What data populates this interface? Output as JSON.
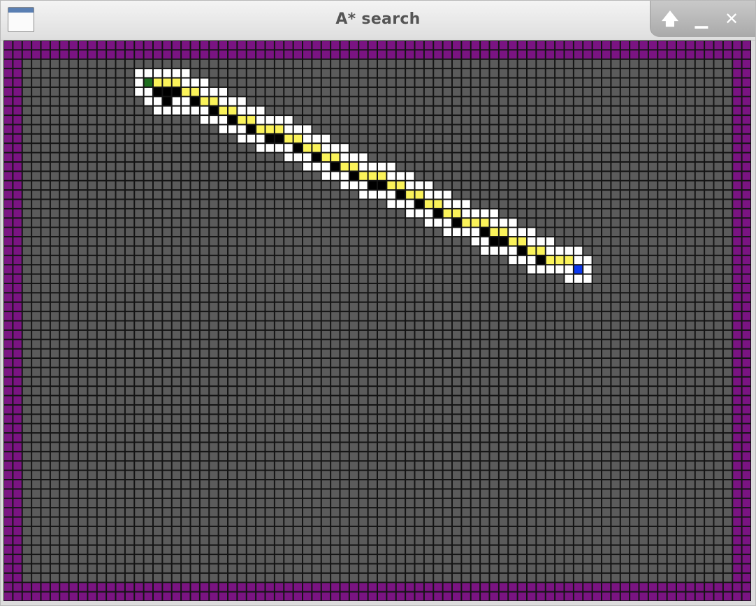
{
  "window": {
    "title": "A* search",
    "icons": {
      "app": "window-app-icon",
      "maximize": "arrow-up-icon",
      "minimize": "minimize-icon",
      "close": "close-icon"
    },
    "control_glyphs": {
      "maximize": "🡅",
      "minimize": "▁",
      "close": "✕"
    }
  },
  "grid": {
    "columns": 80,
    "rows": 60,
    "colors": {
      "empty": "#5b5b5b",
      "grid_line": "#141414",
      "wall": "#7a1482",
      "open": "#ffffff",
      "closed": "#000000",
      "path": "#fbf35a",
      "start": "#1f6e1f",
      "goal": "#0b38f0"
    },
    "start": [
      15,
      4
    ],
    "goal": [
      61,
      24
    ],
    "path": [
      [
        16,
        4
      ],
      [
        17,
        4
      ],
      [
        18,
        4
      ],
      [
        19,
        5
      ],
      [
        20,
        5
      ],
      [
        21,
        6
      ],
      [
        22,
        6
      ],
      [
        23,
        7
      ],
      [
        24,
        7
      ],
      [
        25,
        8
      ],
      [
        26,
        8
      ],
      [
        27,
        9
      ],
      [
        28,
        9
      ],
      [
        29,
        9
      ],
      [
        30,
        10
      ],
      [
        31,
        10
      ],
      [
        32,
        11
      ],
      [
        33,
        11
      ],
      [
        34,
        12
      ],
      [
        35,
        12
      ],
      [
        36,
        13
      ],
      [
        37,
        13
      ],
      [
        38,
        14
      ],
      [
        39,
        14
      ],
      [
        40,
        14
      ],
      [
        41,
        15
      ],
      [
        42,
        15
      ],
      [
        43,
        16
      ],
      [
        44,
        16
      ],
      [
        45,
        17
      ],
      [
        46,
        17
      ],
      [
        47,
        18
      ],
      [
        48,
        18
      ],
      [
        49,
        19
      ],
      [
        50,
        19
      ],
      [
        51,
        19
      ],
      [
        52,
        20
      ],
      [
        53,
        20
      ],
      [
        54,
        21
      ],
      [
        55,
        21
      ],
      [
        56,
        22
      ],
      [
        57,
        22
      ],
      [
        58,
        23
      ],
      [
        59,
        23
      ],
      [
        60,
        23
      ]
    ],
    "closed": [
      [
        16,
        5
      ],
      [
        17,
        5
      ],
      [
        18,
        5
      ],
      [
        17,
        6
      ],
      [
        20,
        6
      ],
      [
        22,
        7
      ],
      [
        24,
        8
      ],
      [
        26,
        9
      ],
      [
        28,
        10
      ],
      [
        29,
        10
      ],
      [
        31,
        11
      ],
      [
        33,
        12
      ],
      [
        35,
        13
      ],
      [
        37,
        14
      ],
      [
        39,
        15
      ],
      [
        40,
        15
      ],
      [
        42,
        16
      ],
      [
        44,
        17
      ],
      [
        46,
        18
      ],
      [
        48,
        19
      ],
      [
        49,
        19
      ],
      [
        51,
        20
      ],
      [
        52,
        21
      ],
      [
        53,
        21
      ],
      [
        55,
        22
      ],
      [
        57,
        23
      ]
    ]
  }
}
